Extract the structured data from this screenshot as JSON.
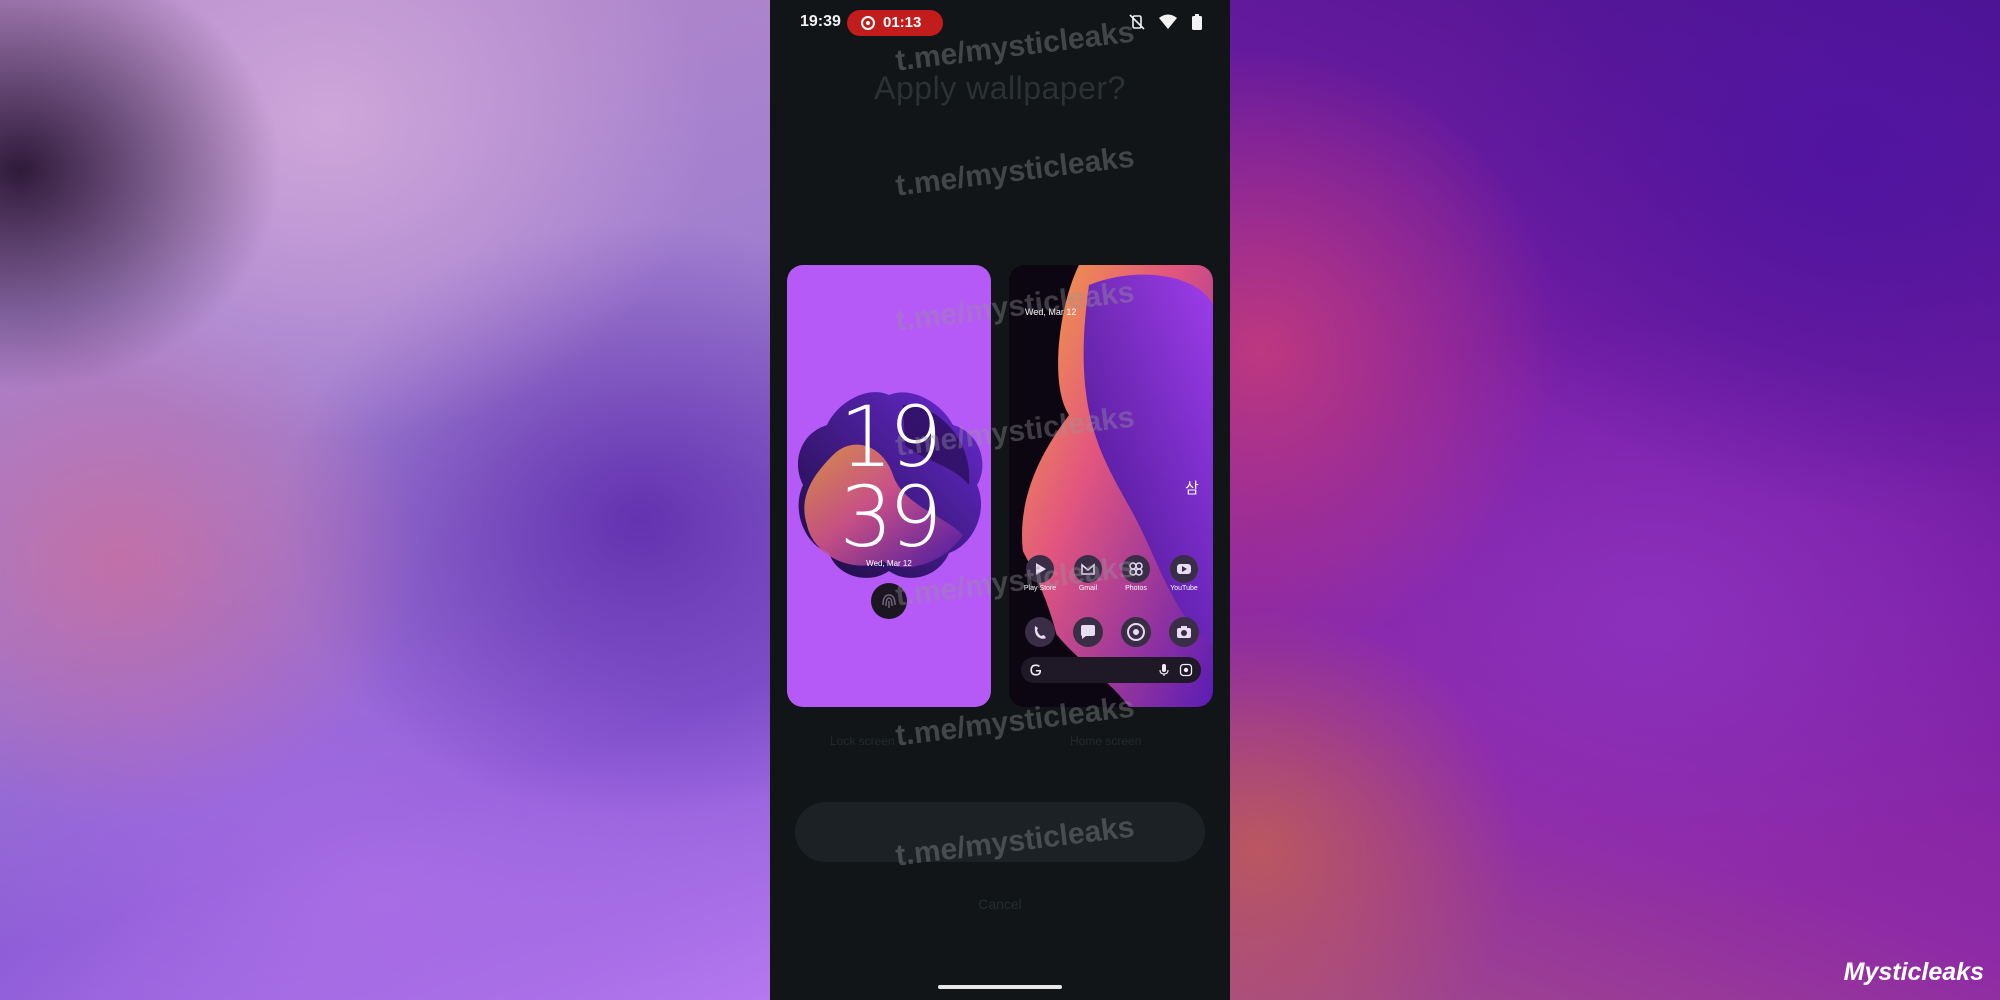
{
  "status_bar": {
    "time": "19:39",
    "recording_time": "01:13"
  },
  "dialog": {
    "title": "Apply wallpaper?",
    "lock_caption": "Lock screen",
    "home_caption": "Home screen",
    "apply_label": "",
    "cancel_label": "Cancel"
  },
  "lock_preview": {
    "hour": "19",
    "minute": "39",
    "date": "Wed, Mar 12"
  },
  "home_preview": {
    "date": "Wed, Mar 12",
    "widget_glyph": "삼",
    "apps": [
      {
        "label": "Play Store",
        "icon": "play-store-icon"
      },
      {
        "label": "Gmail",
        "icon": "gmail-icon"
      },
      {
        "label": "Photos",
        "icon": "photos-icon"
      },
      {
        "label": "YouTube",
        "icon": "youtube-icon"
      }
    ],
    "dock": [
      "phone-icon",
      "messages-icon",
      "chrome-icon",
      "camera-icon"
    ],
    "search_icons": [
      "google-g-icon",
      "mic-icon",
      "lens-icon"
    ]
  },
  "watermark": {
    "text": "t.me/mysticleaks"
  },
  "brand": {
    "text": "Mysticleaks"
  },
  "colors": {
    "lock_bg": "#b559f7",
    "record_pill": "#c21c1c",
    "screen_bg": "#111517"
  }
}
